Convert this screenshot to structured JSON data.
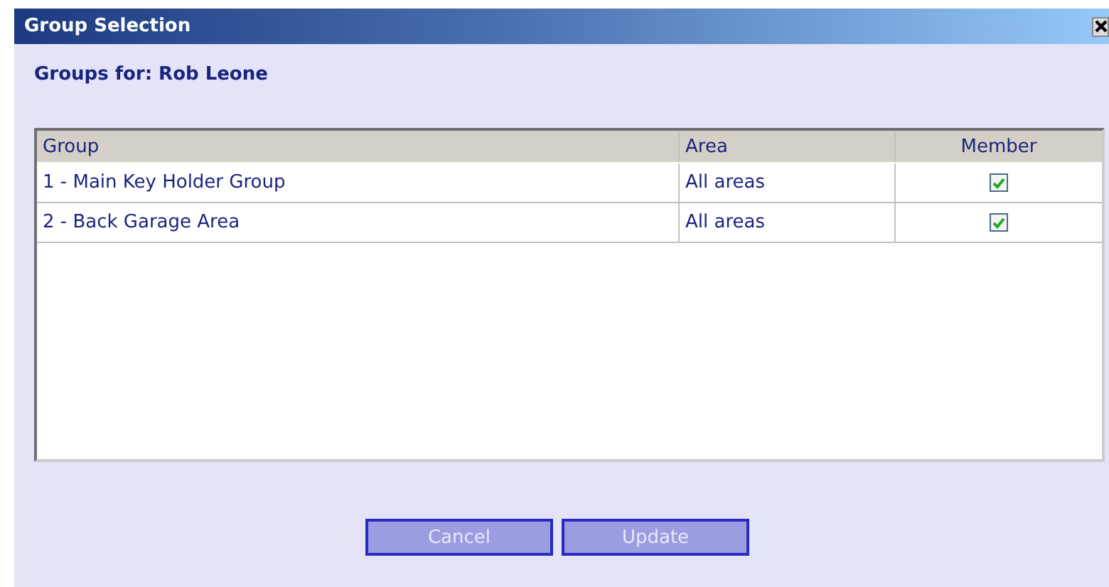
{
  "window": {
    "title": "Group Selection"
  },
  "heading": "Groups for: Rob Leone",
  "table": {
    "columns": [
      "Group",
      "Area",
      "Member"
    ],
    "rows": [
      {
        "group": "1 - Main Key Holder Group",
        "area": "All areas",
        "checked": true
      },
      {
        "group": "2 - Back Garage Area",
        "area": "All areas",
        "checked": true
      }
    ]
  },
  "buttons": [
    "Cancel",
    "Update"
  ]
}
